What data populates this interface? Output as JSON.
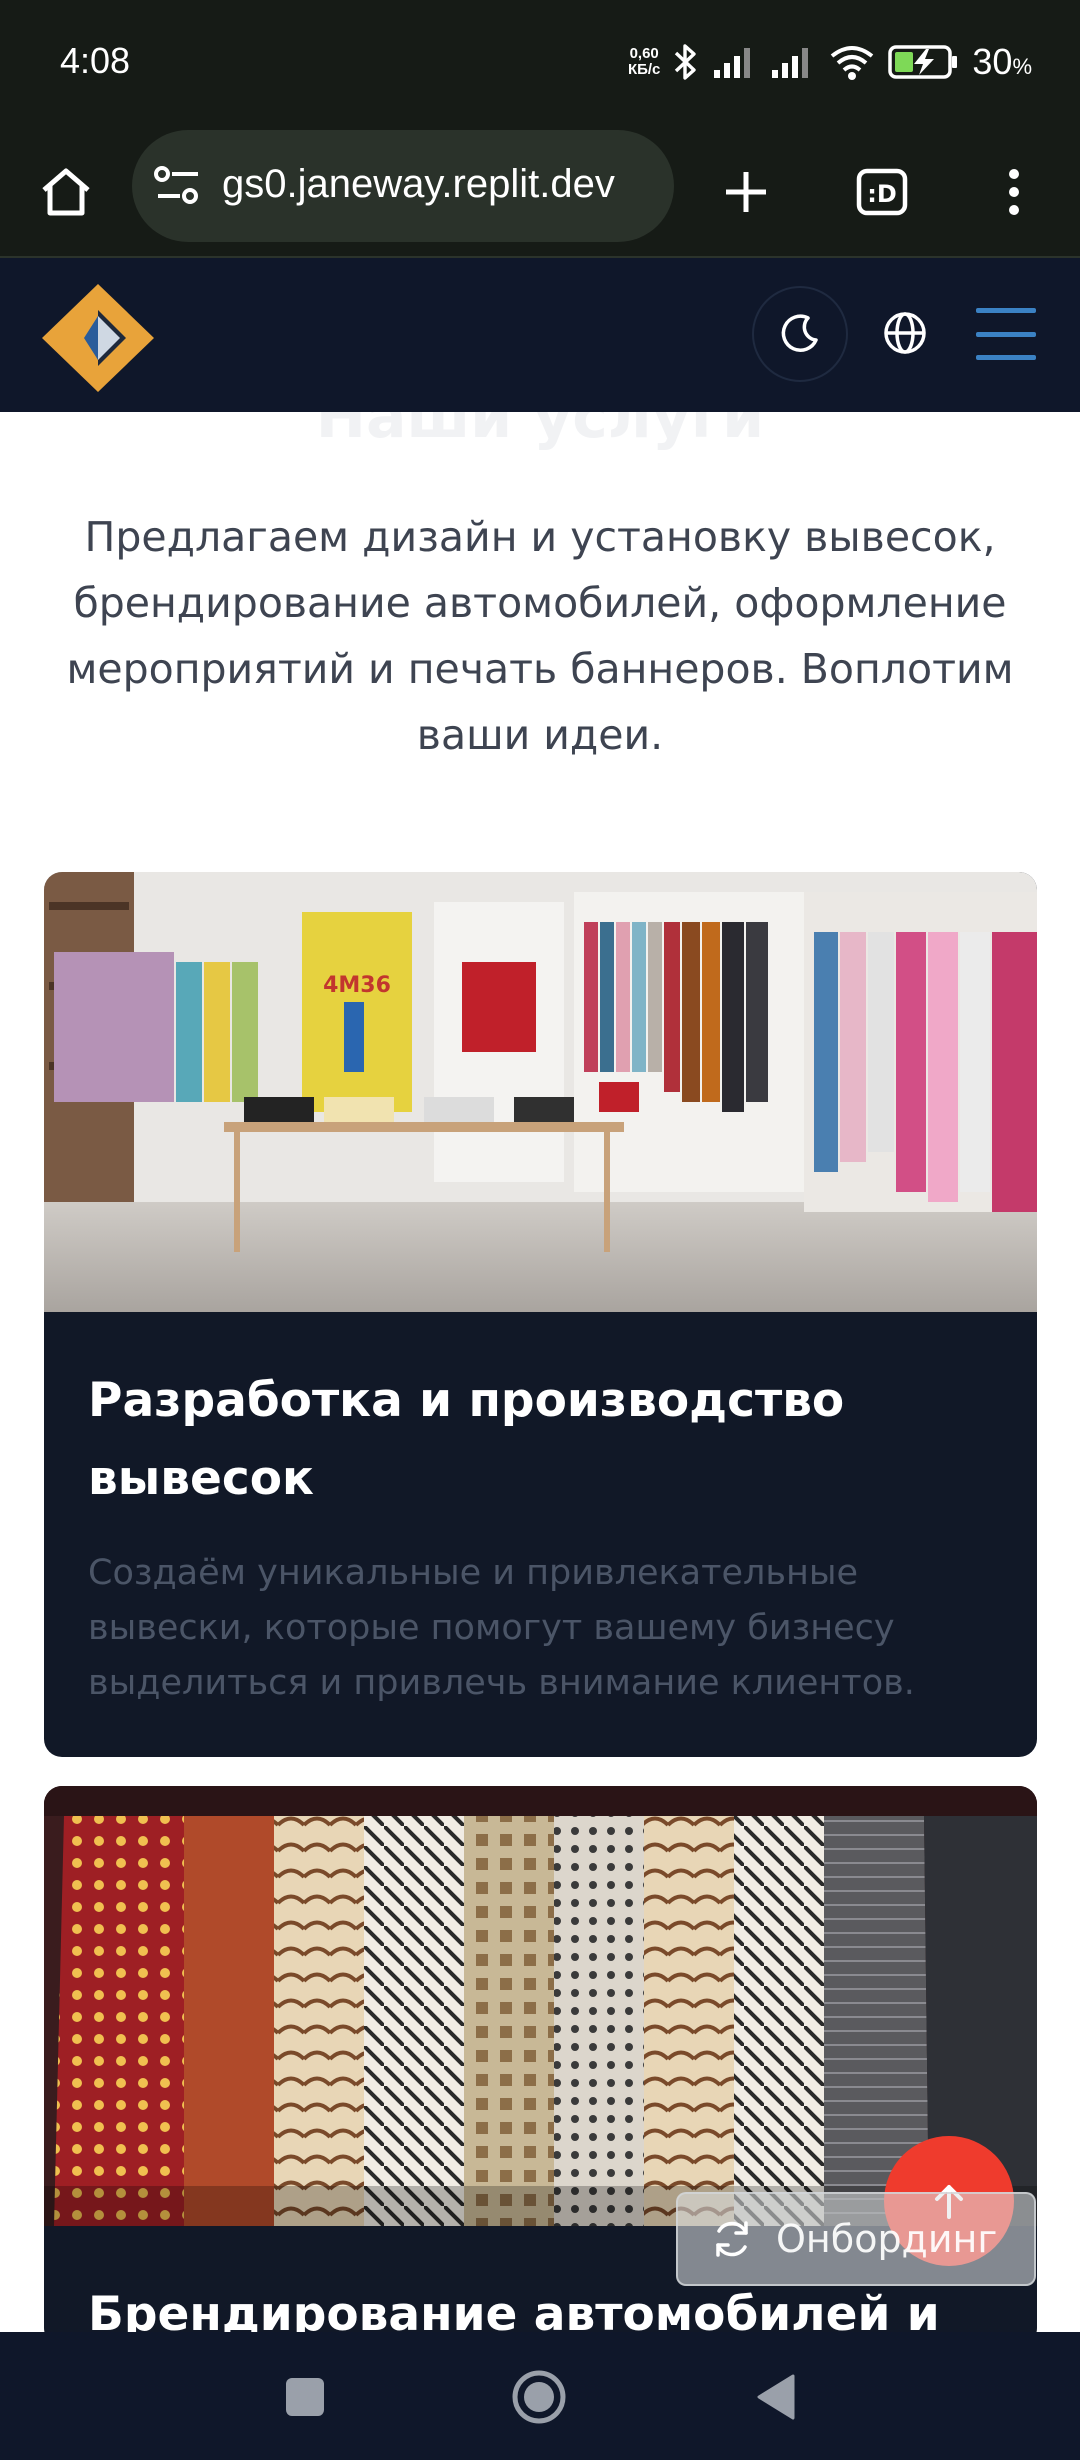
{
  "status_bar": {
    "time": "4:08",
    "net_speed_top": "0,60",
    "net_speed_bottom": "КБ/с",
    "battery_percent": "30",
    "battery_unit": "%"
  },
  "browser": {
    "url": "gs0.janeway.replit.dev"
  },
  "site_header": {
    "logo_colors": {
      "gold": "#e8a33a",
      "blue": "#2a5c9a"
    }
  },
  "main": {
    "section_heading": "Наши услуги",
    "lead": "Предлагаем дизайн и установку вывесок, брендирование автомобилей, оформление мероприятий и печать баннеров. Воплотим ваши идеи.",
    "cards": [
      {
        "title": "Разработка и производство вывесок",
        "description": "Создаём уникальные и привлекательные вывески, которые помогут вашему бизнесу выделиться и привлечь внимание клиентов."
      },
      {
        "title": "Брендирование автомобилей и"
      }
    ]
  },
  "floating": {
    "onboarding_label": "Онбординг"
  },
  "colors": {
    "header_bg": "#0f172a",
    "card_bg": "#111827",
    "accent_red": "#ef3b2d",
    "browser_bg": "#161b16"
  }
}
